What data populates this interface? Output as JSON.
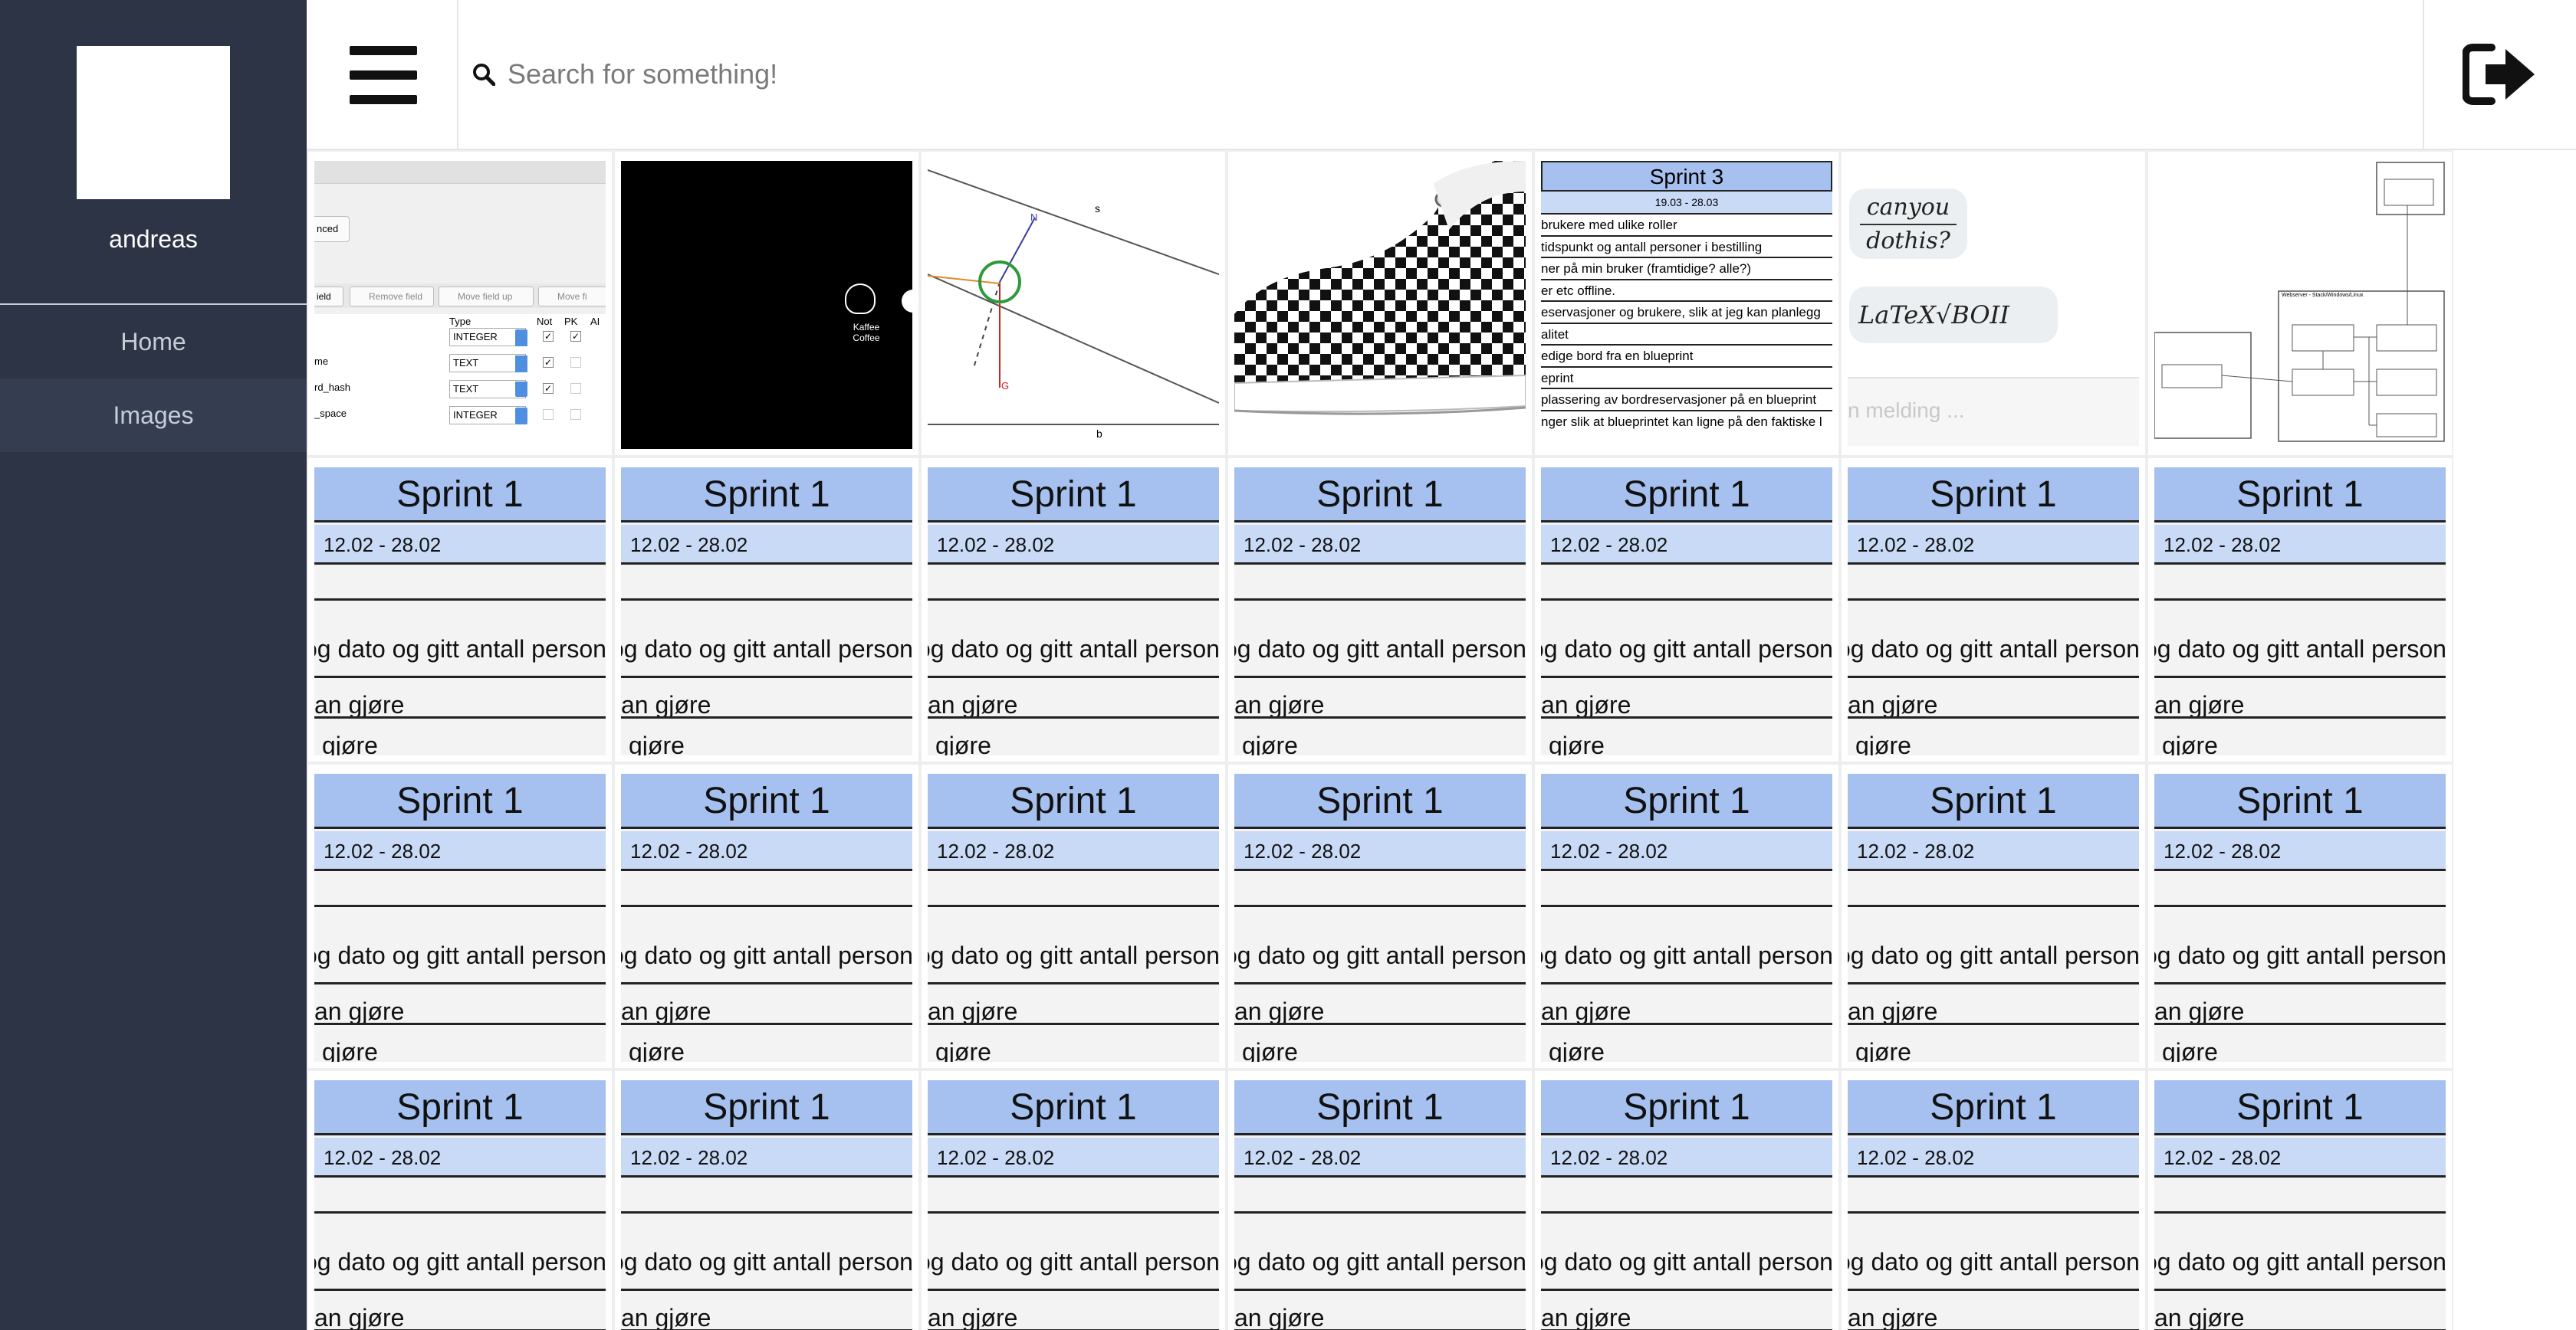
{
  "sidebar": {
    "username": "andreas",
    "nav": [
      {
        "label": "Home"
      },
      {
        "label": "Images"
      }
    ]
  },
  "topbar": {
    "menu_icon": "hamburger-icon",
    "search_icon": "search-icon",
    "search_placeholder": "Search for something!",
    "logout_icon": "logout-icon"
  },
  "gallery": {
    "row1": {
      "db_table": {
        "advanced_btn": "nced",
        "field_btn": "ield",
        "remove_btn": "Remove field",
        "up_btn": "Move field up",
        "down_btn": "Move fi",
        "col_type": "Type",
        "col_not": "Not",
        "col_pk": "PK",
        "col_ai": "AI",
        "rows": [
          {
            "name": "",
            "type": "INTEGER"
          },
          {
            "name": "me",
            "type": "TEXT"
          },
          {
            "name": "rd_hash",
            "type": "TEXT"
          },
          {
            "name": "_space",
            "type": "INTEGER"
          }
        ]
      },
      "coffee": {
        "line1": "Kaffee",
        "line2": "Coffee"
      },
      "physics": {
        "label_s": "s",
        "label_n": "N",
        "label_g": "G",
        "label_b": "b"
      },
      "sprint3": {
        "title": "Sprint 3",
        "date": "19.03 - 28.03",
        "lines": [
          "brukere med ulike roller",
          "tidspunkt og antall personer i bestilling",
          "ner på min bruker (framtidige? alle?)",
          "er etc offline.",
          "eservasjoner og brukere, slik at jeg kan planlegg",
          "alitet",
          "edige bord fra en blueprint",
          "eprint",
          "plassering av bordreservasjoner på en blueprint",
          "nger slik at blueprintet kan ligne på den faktiske l"
        ]
      },
      "chat": {
        "bubble1_line1": "canyou",
        "bubble1_line2": "dothis?",
        "bubble2": "LaTeX√BOII",
        "input_placeholder": "n melding ..."
      },
      "diagram": {
        "title": "Webserver - Stack/Windows/Linux"
      }
    },
    "sprint1": {
      "title": "Sprint 1",
      "date": "12.02 - 28.02",
      "row2": "og dato og gitt antall personer",
      "row3": "an gjøre",
      "row4": "gjøre"
    }
  }
}
